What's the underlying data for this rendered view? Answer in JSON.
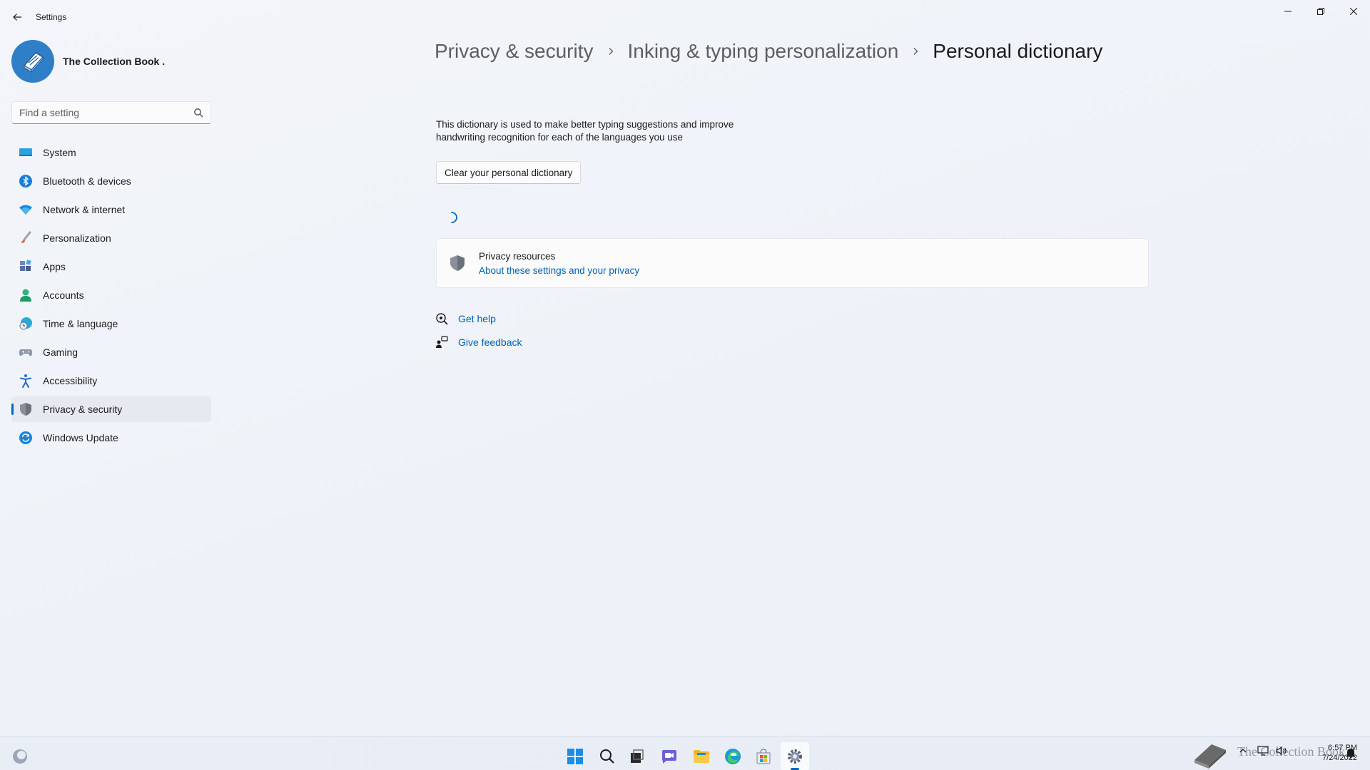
{
  "window": {
    "title": "Settings"
  },
  "profile": {
    "name": "The Collection Book ."
  },
  "search": {
    "placeholder": "Find a setting"
  },
  "sidebar": {
    "items": [
      {
        "label": "System",
        "icon": "monitor-icon"
      },
      {
        "label": "Bluetooth & devices",
        "icon": "bluetooth-icon"
      },
      {
        "label": "Network & internet",
        "icon": "wifi-icon"
      },
      {
        "label": "Personalization",
        "icon": "brush-icon"
      },
      {
        "label": "Apps",
        "icon": "apps-icon"
      },
      {
        "label": "Accounts",
        "icon": "person-icon"
      },
      {
        "label": "Time & language",
        "icon": "globe-clock-icon"
      },
      {
        "label": "Gaming",
        "icon": "gamepad-icon"
      },
      {
        "label": "Accessibility",
        "icon": "accessibility-icon"
      },
      {
        "label": "Privacy & security",
        "icon": "shield-icon",
        "active": true
      },
      {
        "label": "Windows Update",
        "icon": "update-icon"
      }
    ]
  },
  "breadcrumb": {
    "level1": "Privacy & security",
    "level2": "Inking & typing personalization",
    "current": "Personal dictionary"
  },
  "content": {
    "description": "This dictionary is used to make better typing suggestions and improve handwriting recognition for each of the languages you use",
    "clear_button": "Clear your personal dictionary"
  },
  "privacy_card": {
    "title": "Privacy resources",
    "link": "About these settings and your privacy"
  },
  "help": {
    "get_help": "Get help",
    "give_feedback": "Give feedback"
  },
  "taskbar": {
    "icons": [
      "widgets-icon",
      "start-icon",
      "search-icon",
      "task-view-icon",
      "chat-icon",
      "file-explorer-icon",
      "edge-icon",
      "store-icon",
      "settings-icon"
    ],
    "active": "settings-icon",
    "watermark": "The Collection Book"
  },
  "clock": {
    "time": "6:57 PM",
    "date": "7/24/2022"
  },
  "colors": {
    "accent": "#0067c0",
    "link": "#005fb8"
  }
}
